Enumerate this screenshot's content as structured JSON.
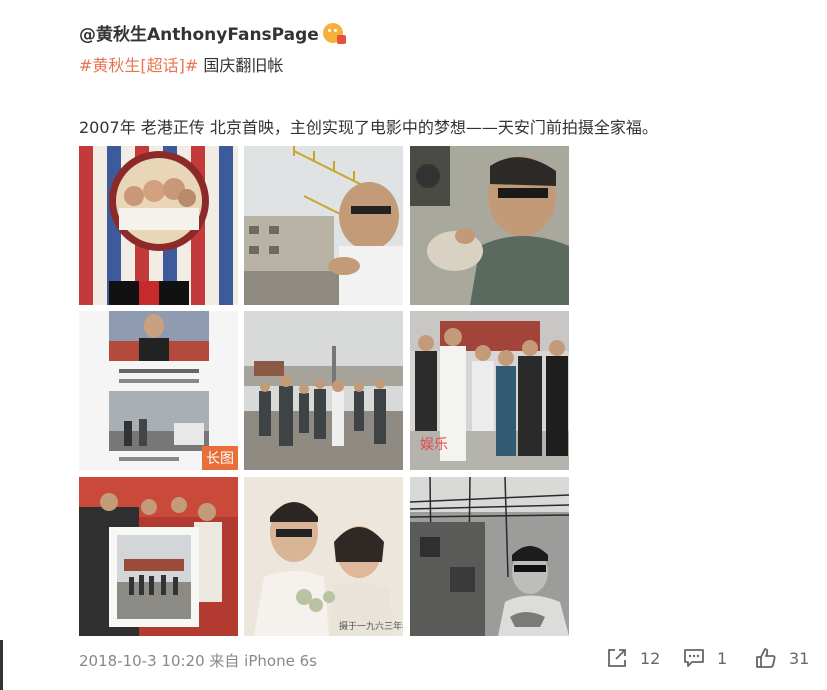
{
  "post": {
    "author": "@黄秋生AnthonyFansPage",
    "author_badge_icon": "vip-emoji-badge-icon",
    "topic_tag": "#黄秋生[超话]#",
    "tag_text": "国庆翻旧帐",
    "text": "2007年 老港正传 北京首映，主创实现了电影中的梦想——天安门前拍摄全家福。",
    "long_image_label": "长图",
    "timestamp": "2018-10-3 10:20",
    "source": "来自 iPhone 6s"
  },
  "actions": {
    "share_count": "12",
    "comment_count": "1",
    "like_count": "31"
  },
  "photos": [
    {
      "name": "movie-poster-photo"
    },
    {
      "name": "rooftop-antennas-photo"
    },
    {
      "name": "man-with-glasses-photo"
    },
    {
      "name": "long-image-collage-photo"
    },
    {
      "name": "tiananmen-crowd-photo"
    },
    {
      "name": "cast-group-photo"
    },
    {
      "name": "premiere-framed-photo"
    },
    {
      "name": "vintage-couple-photo"
    },
    {
      "name": "bw-wires-portrait-photo"
    }
  ],
  "colors": {
    "topic": "#eb7350",
    "long_badge": "#e86e3a",
    "text": "#333333",
    "meta": "#888888"
  }
}
